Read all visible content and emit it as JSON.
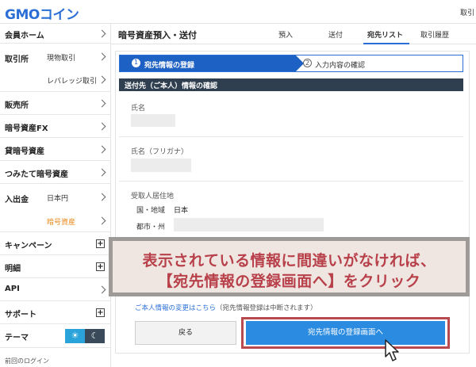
{
  "header": {
    "logo": "GMOコイン",
    "right_text": "取引"
  },
  "sidebar": {
    "items": [
      {
        "label": "会員ホーム"
      },
      {
        "label": "取引所",
        "subs": [
          "現物取引",
          "レバレッジ取引"
        ]
      },
      {
        "label": "販売所"
      },
      {
        "label": "暗号資産FX"
      },
      {
        "label": "貸暗号資産"
      },
      {
        "label": "つみたて暗号資産"
      },
      {
        "label": "入出金",
        "subs": [
          "日本円",
          "暗号資産"
        ]
      },
      {
        "label": "キャンペーン"
      },
      {
        "label": "明細"
      },
      {
        "label": "API"
      },
      {
        "label": "サポート"
      },
      {
        "label": "テーマ"
      }
    ],
    "last_login": "前回のログイン",
    "theme_icons": {
      "light": "sun-icon",
      "dark": "moon-icon"
    }
  },
  "main": {
    "title": "暗号資産預入・送付",
    "tabs": [
      "預入",
      "送付",
      "宛先リスト",
      "取引履歴"
    ],
    "active_tab": "宛先リスト",
    "steps": [
      {
        "num": "1",
        "label": "宛先情報の登録"
      },
      {
        "num": "2",
        "label": "入力内容の確認"
      }
    ],
    "section_title": "送付先（ご本人）情報の確認",
    "fields": {
      "name_label": "氏名",
      "kana_label": "氏名（フリガナ）",
      "address_label": "受取人居住地",
      "country_label": "国・地域",
      "country_value": "日本",
      "city_label": "都市・州"
    },
    "notice_link": "ご本人情報の変更はこちら",
    "notice_note": "（宛先情報登録は中断されます）",
    "back_button": "戻る",
    "submit_button": "宛先情報の登録画面へ"
  },
  "annotation": {
    "line1": "表示されている情報に間違いがなければ、",
    "line2": "【宛先情報の登録画面へ】をクリック"
  },
  "colors": {
    "brand_blue": "#1e61c4",
    "button_blue": "#2a8be0",
    "accent_orange": "#e88a1a",
    "annotation_red": "#b8404a",
    "section_dark": "#2f3f4f"
  }
}
